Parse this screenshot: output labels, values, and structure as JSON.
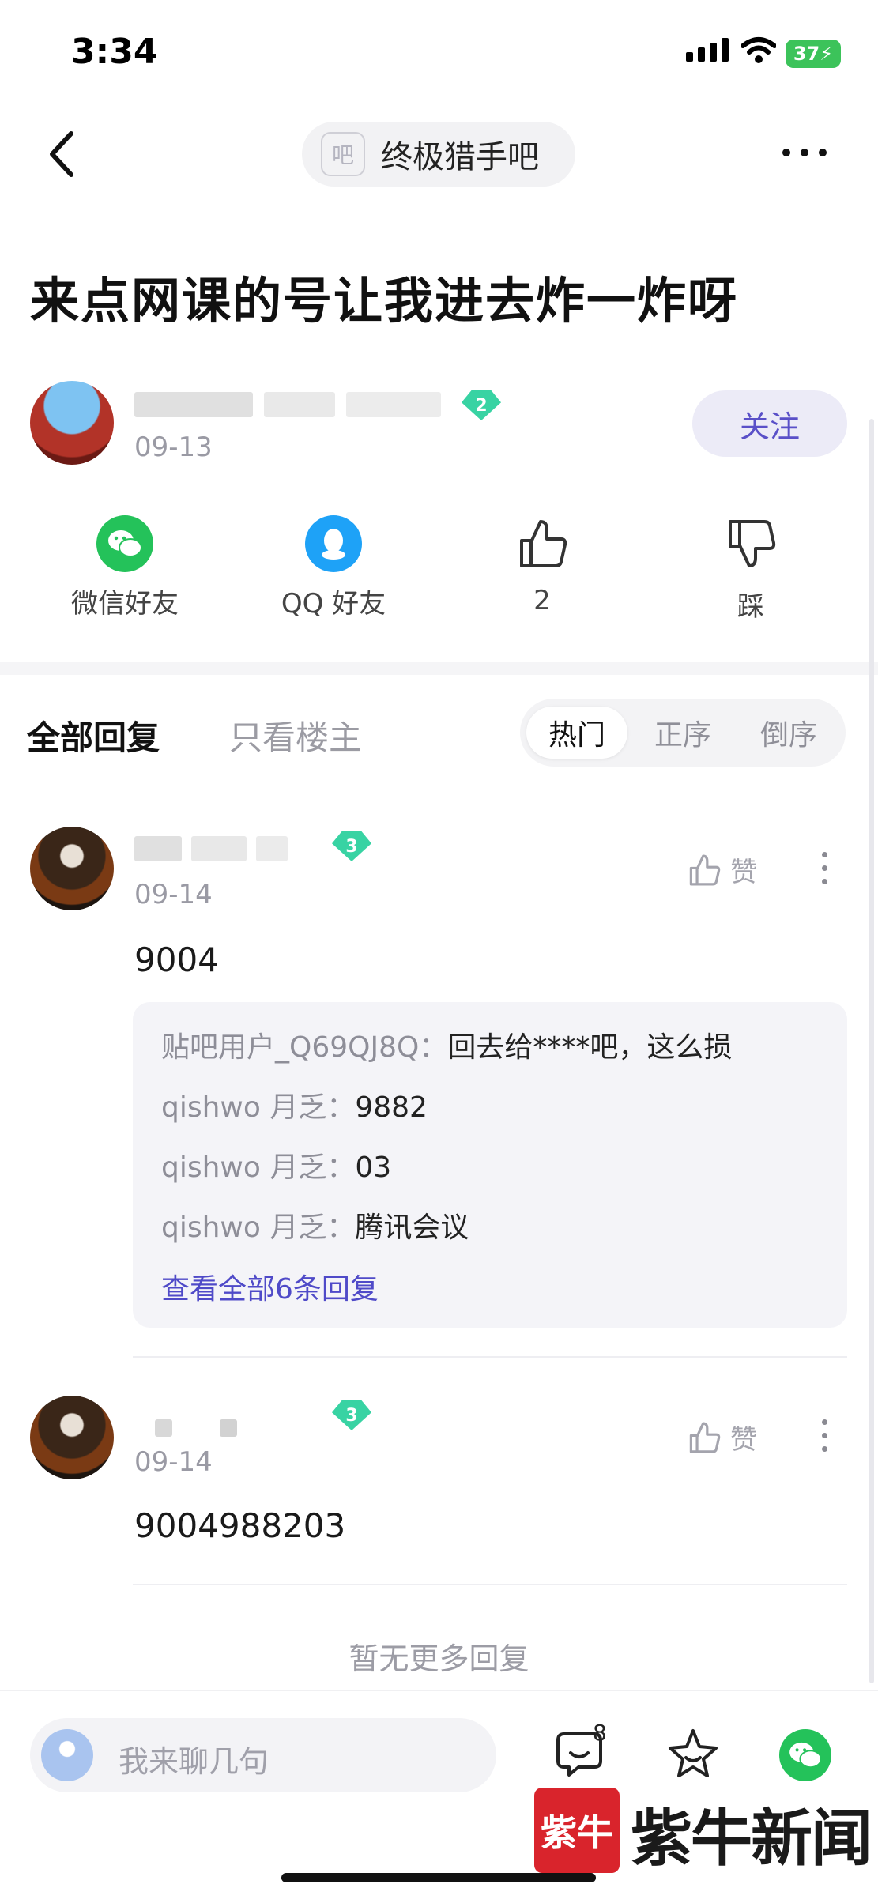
{
  "status_bar": {
    "time": "3:34",
    "battery": "37"
  },
  "nav": {
    "forum_icon_glyph": "吧",
    "forum_name": "终极猎手吧"
  },
  "post": {
    "title": "来点网课的号让我进去炸一炸呀",
    "author": {
      "level": "2",
      "date": "09-13"
    },
    "follow_label": "关注"
  },
  "share": {
    "wechat_label": "微信好友",
    "qq_label": "QQ 好友",
    "like_count": "2",
    "dislike_label": "踩"
  },
  "reply_tabs": {
    "all": "全部回复",
    "op_only": "只看楼主",
    "sort": [
      "热门",
      "正序",
      "倒序"
    ]
  },
  "comments": [
    {
      "level": "3",
      "date": "09-14",
      "body": "9004",
      "like_label": "赞",
      "replies": [
        {
          "user": "贴吧用户_Q69QJ8Q：",
          "text": "回去给****吧，这么损"
        },
        {
          "user": "qishwo 月乏：",
          "text": "9882"
        },
        {
          "user": "qishwo 月乏：",
          "text": "03"
        },
        {
          "user": "qishwo 月乏：",
          "text": "腾讯会议"
        }
      ],
      "view_all": "查看全部6条回复"
    },
    {
      "level": "3",
      "date": "09-14",
      "body": "9004988203",
      "like_label": "赞"
    }
  ],
  "no_more": "暂无更多回复",
  "bottom": {
    "input_placeholder": "我来聊几句",
    "comment_count": "8"
  },
  "watermark": {
    "box": "紫牛",
    "text": "紫牛新闻"
  },
  "colors": {
    "accent": "#5a50c8",
    "level_badge": "#38d3a3",
    "wechat": "#24c25a",
    "qq": "#1ea2f7",
    "watermark_red": "#d9242c"
  }
}
